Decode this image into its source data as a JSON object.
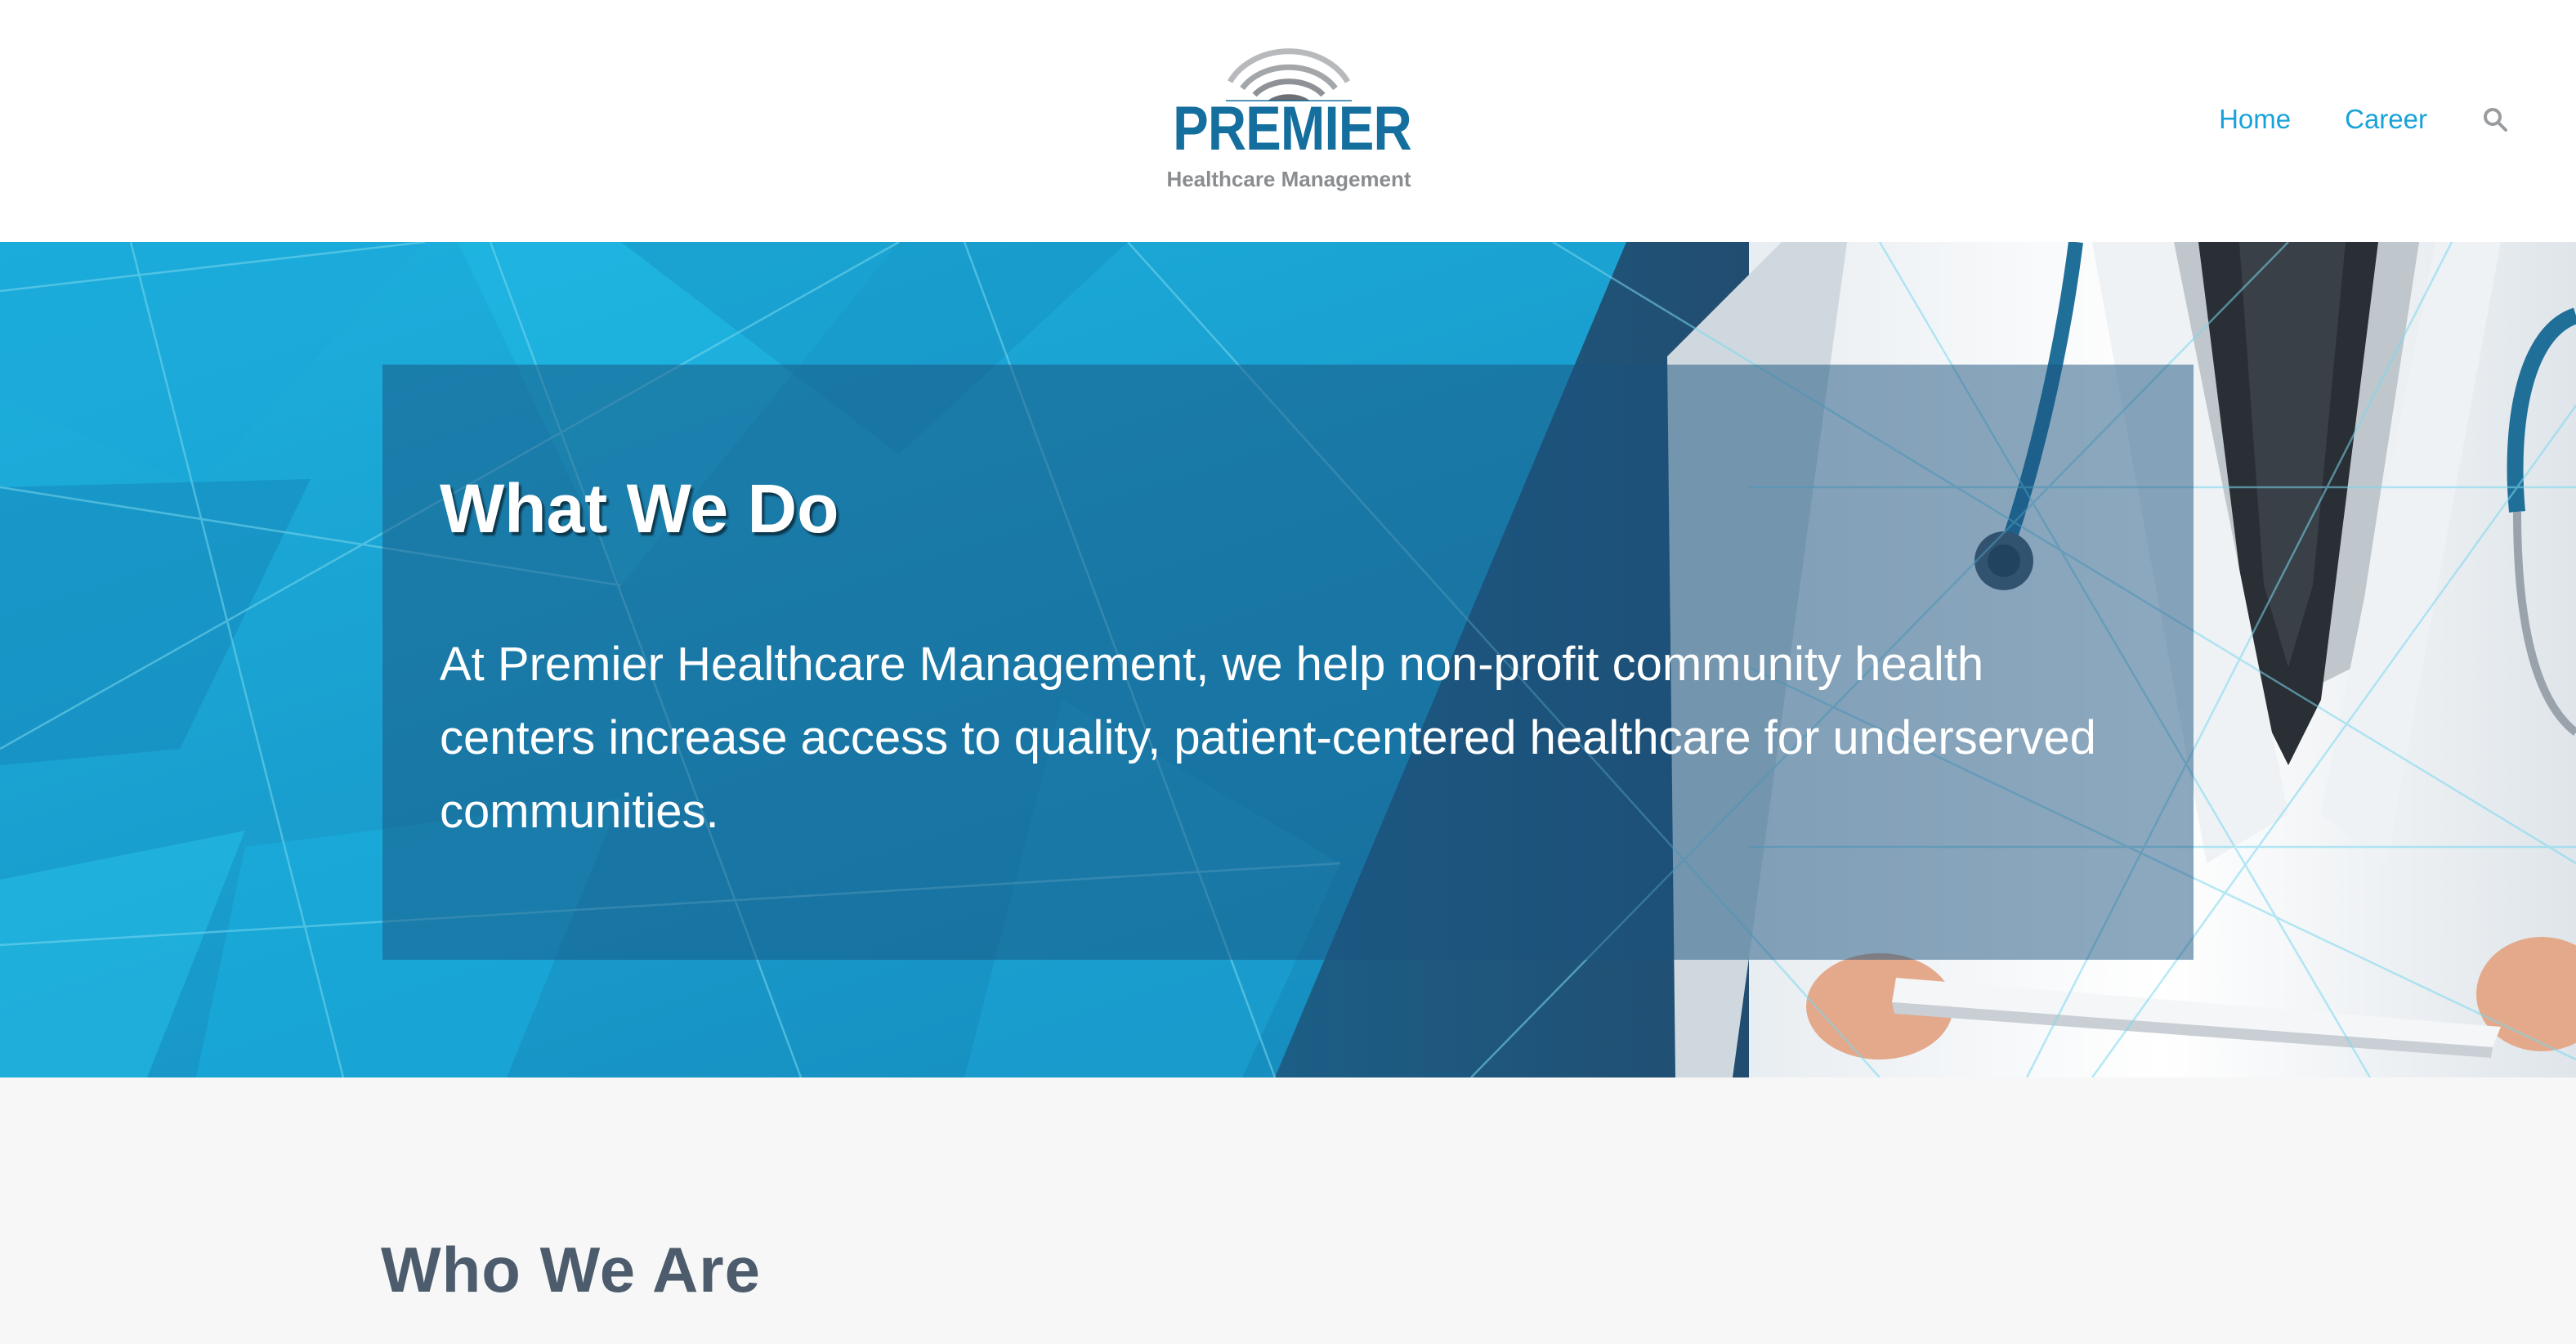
{
  "brand": {
    "name": "PREMIER",
    "tagline": "Healthcare Management"
  },
  "nav": {
    "items": [
      {
        "label": "Home"
      },
      {
        "label": "Career"
      }
    ],
    "search_icon": "search-icon"
  },
  "hero": {
    "title": "What We Do",
    "text": "At Premier Healthcare Management, we help non-profit community health centers increase access to quality, patient-centered healthcare for underserved communities."
  },
  "about": {
    "title": "Who We Are"
  },
  "colors": {
    "brand_blue": "#156f9e",
    "link_blue": "#17a3d9",
    "hero_blue": "#1a9ccc",
    "heading_gray": "#4c5c6c",
    "section_bg": "#f7f7f7"
  }
}
